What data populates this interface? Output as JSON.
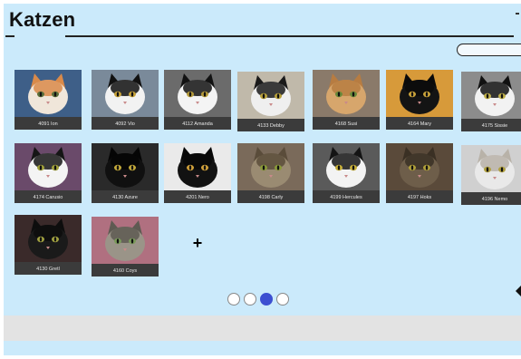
{
  "header": {
    "title": "Katzen"
  },
  "cats": [
    {
      "caption": "4091 Ion",
      "fur": "#f0e6da",
      "accent": "#d98a4a",
      "eye": "#5a6e3a",
      "bg": "#3e5f88"
    },
    {
      "caption": "4092 Vio",
      "fur": "#f2f2f2",
      "accent": "#111111",
      "eye": "#c7a23a",
      "bg": "#7a8a9a"
    },
    {
      "caption": "4112 Amanda",
      "fur": "#f4f4f4",
      "accent": "#121212",
      "eye": "#b59a3a",
      "bg": "#6b6b6b"
    },
    {
      "caption": "4133 Debby",
      "fur": "#efefef",
      "accent": "#1a1a1a",
      "eye": "#b8a03a",
      "bg": "#c0b9aa"
    },
    {
      "caption": "4168 Susi",
      "fur": "#d7a66c",
      "accent": "#b77c41",
      "eye": "#6b8a3a",
      "bg": "#8a7a6a"
    },
    {
      "caption": "4164 Mary",
      "fur": "#141414",
      "accent": "#0a0a0a",
      "eye": "#c9a23a",
      "bg": "#d79a3a"
    },
    {
      "caption": "4175 Sissie",
      "fur": "#f2f2f2",
      "accent": "#111111",
      "eye": "#c0b04a",
      "bg": "#8c8c8c"
    },
    {
      "caption": "4174 Carusio",
      "fur": "#f4f4f4",
      "accent": "#151515",
      "eye": "#a0a03a",
      "bg": "#6a4a6a"
    },
    {
      "caption": "4130 Azure",
      "fur": "#101010",
      "accent": "#050505",
      "eye": "#c2a83a",
      "bg": "#2a2a2a"
    },
    {
      "caption": "4201 Nero",
      "fur": "#121212",
      "accent": "#080808",
      "eye": "#d0a03a",
      "bg": "#eaeaea"
    },
    {
      "caption": "4198 Carly",
      "fur": "#9a8b72",
      "accent": "#5a4c3a",
      "eye": "#8a9a3a",
      "bg": "#7a6a5a"
    },
    {
      "caption": "4199 Hercules",
      "fur": "#f3f3f3",
      "accent": "#141414",
      "eye": "#c7b03a",
      "bg": "#5a5a5a"
    },
    {
      "caption": "4197 Hoks",
      "fur": "#6e5e4a",
      "accent": "#3a3024",
      "eye": "#b0a03a",
      "bg": "#5a4a3a"
    },
    {
      "caption": "4196 Nemo",
      "fur": "#e9e9e9",
      "accent": "#b8b2a8",
      "eye": "#b0a040",
      "bg": "#d0d0d0"
    },
    {
      "caption": "4130 Gretl",
      "fur": "#1a1a1a",
      "accent": "#0d0d0d",
      "eye": "#a0a040",
      "bg": "#3a2a2a"
    },
    {
      "caption": "4160 Coys",
      "fur": "#9a9488",
      "accent": "#5e5a52",
      "eye": "#7a9a5a",
      "bg": "#b07080"
    }
  ],
  "add_label": "+",
  "pager": {
    "pages": 4,
    "active": 3
  }
}
